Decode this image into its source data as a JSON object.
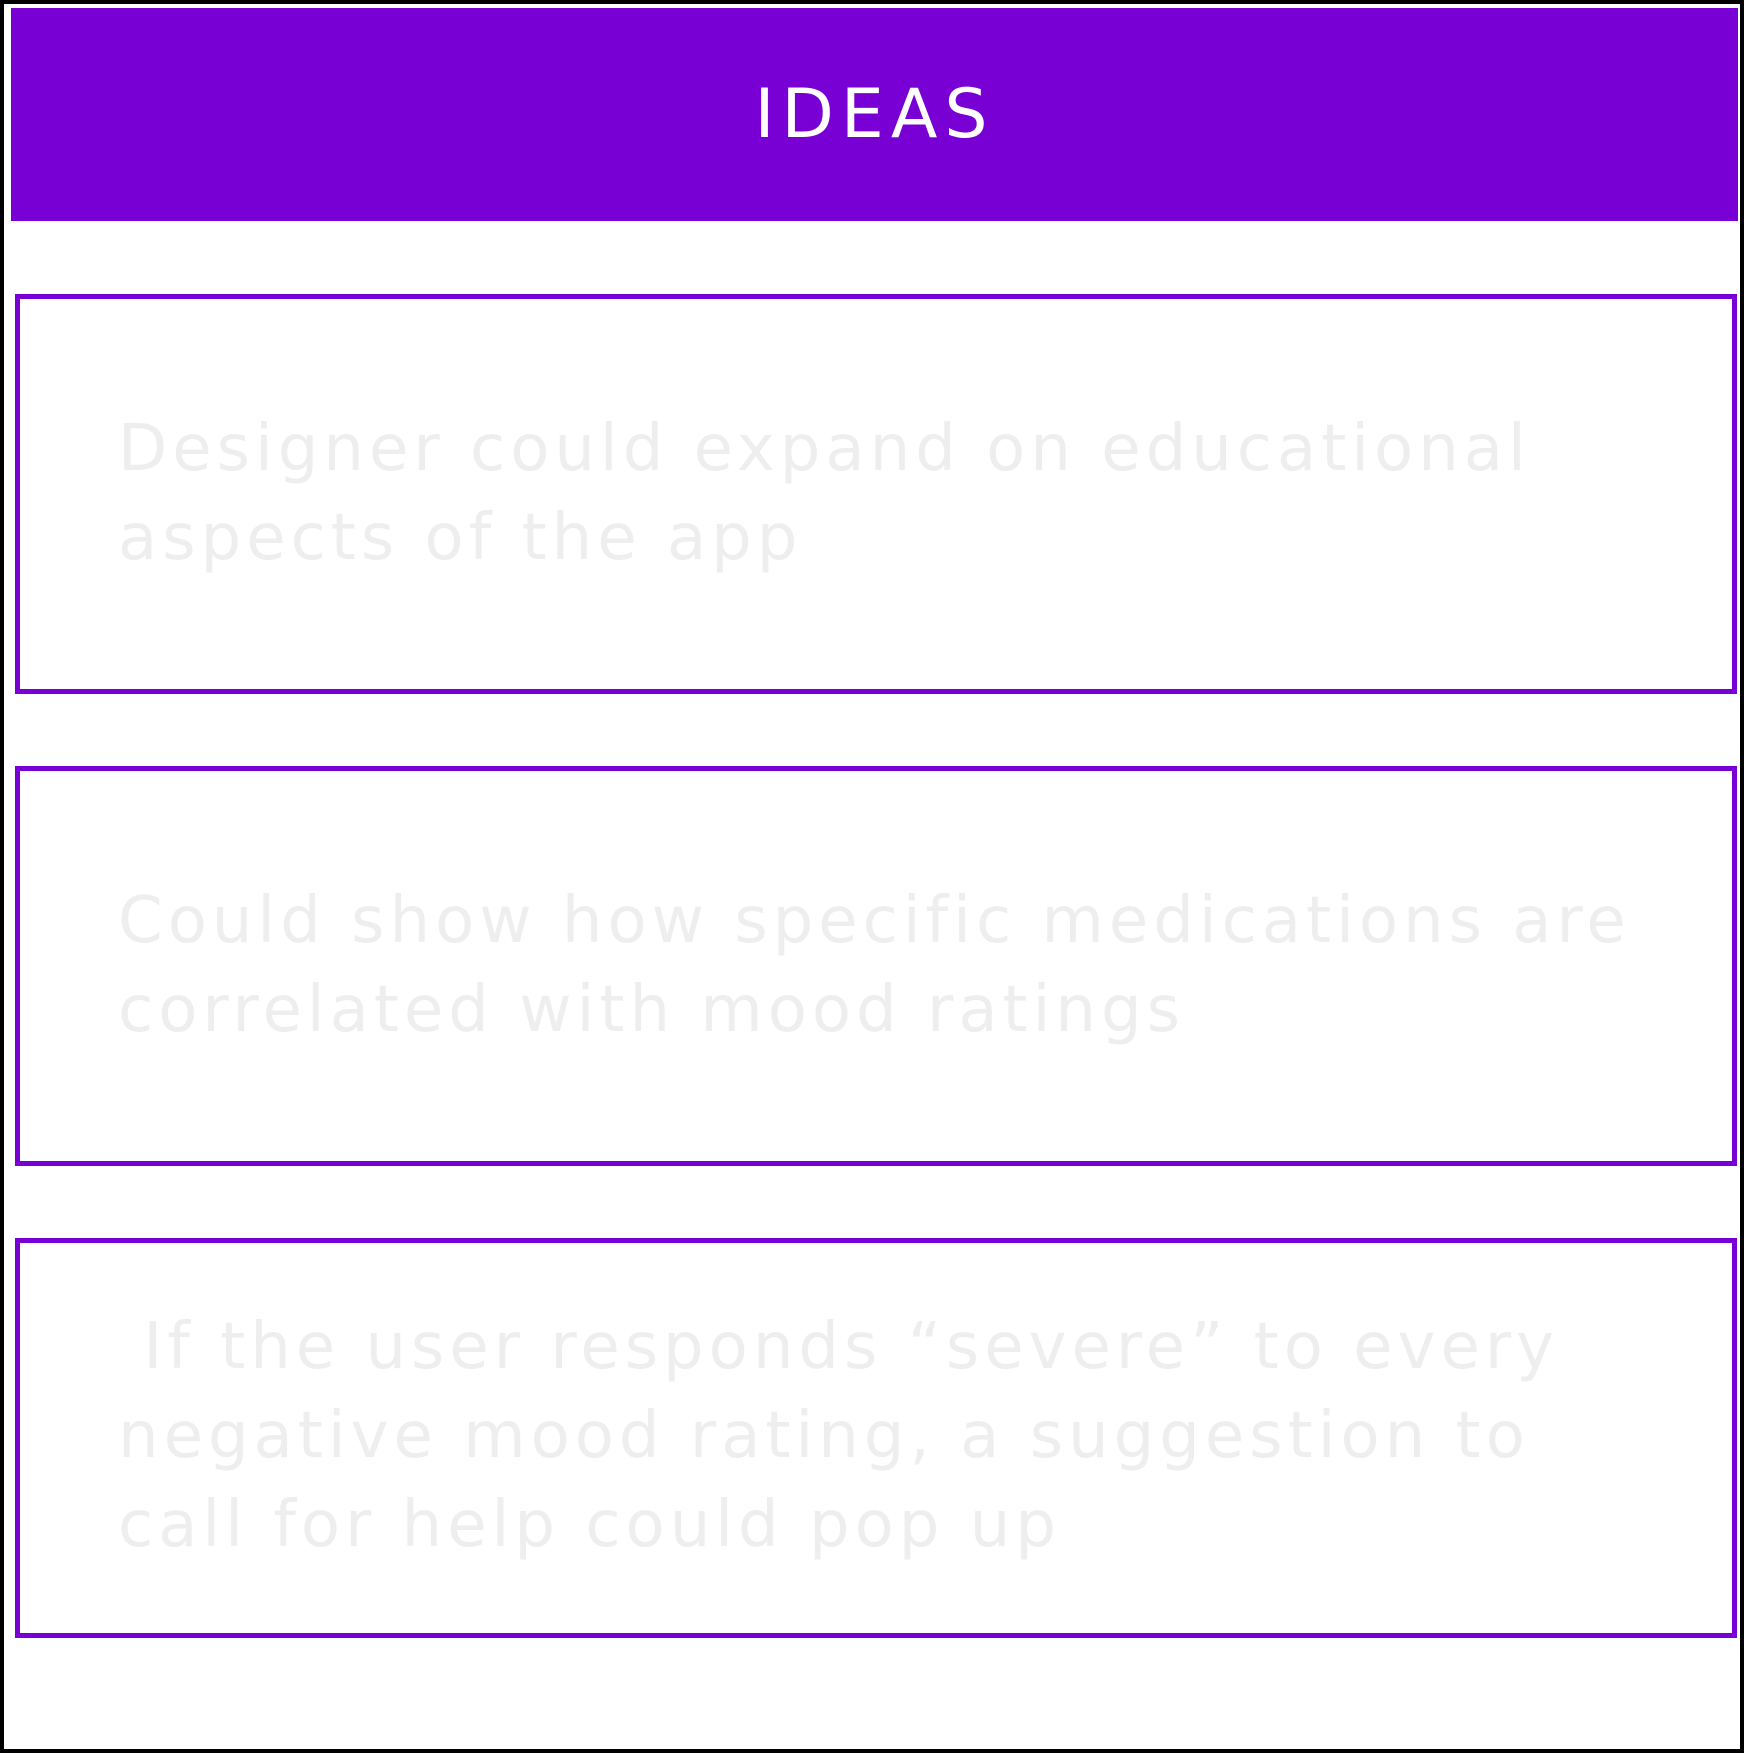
{
  "header": {
    "title": "IDEAS",
    "background_color": "#7800d4"
  },
  "ideas": [
    {
      "text": "Designer could expand on educational\naspects of the app"
    },
    {
      "text": "Could show how specific medications are\ncorrelated with mood ratings"
    },
    {
      "text": " If the user responds “severe” to every\nnegative mood rating, a suggestion to\ncall for help could pop up"
    }
  ],
  "colors": {
    "accent": "#7800d4",
    "idea_text": "#eeeeee",
    "frame_border": "#000000"
  }
}
